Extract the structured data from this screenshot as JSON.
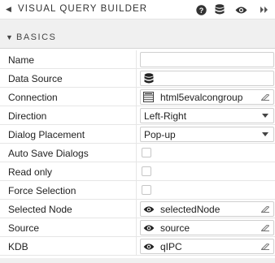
{
  "header": {
    "title": "VISUAL QUERY BUILDER",
    "icons": [
      "help-icon",
      "database-icon",
      "eye-icon",
      "collapse-right-icon"
    ]
  },
  "section": {
    "label": "BASICS",
    "expanded": true
  },
  "fields": {
    "name": {
      "label": "Name",
      "value": ""
    },
    "data_source": {
      "label": "Data Source",
      "value": ""
    },
    "connection": {
      "label": "Connection",
      "value": "html5evalcongroup"
    },
    "direction": {
      "label": "Direction",
      "value": "Left-Right"
    },
    "dialog_placement": {
      "label": "Dialog Placement",
      "value": "Pop-up"
    },
    "auto_save_dialogs": {
      "label": "Auto Save Dialogs",
      "checked": false
    },
    "read_only": {
      "label": "Read only",
      "checked": false
    },
    "force_selection": {
      "label": "Force Selection",
      "checked": false
    },
    "selected_node": {
      "label": "Selected Node",
      "value": "selectedNode"
    },
    "source": {
      "label": "Source",
      "value": "source"
    },
    "kdb": {
      "label": "KDB",
      "value": "qIPC"
    }
  },
  "colors": {
    "panel_bg": "#ffffff",
    "header_bg": "#f0f0f0",
    "border": "#cfcfcf",
    "text": "#222222"
  }
}
